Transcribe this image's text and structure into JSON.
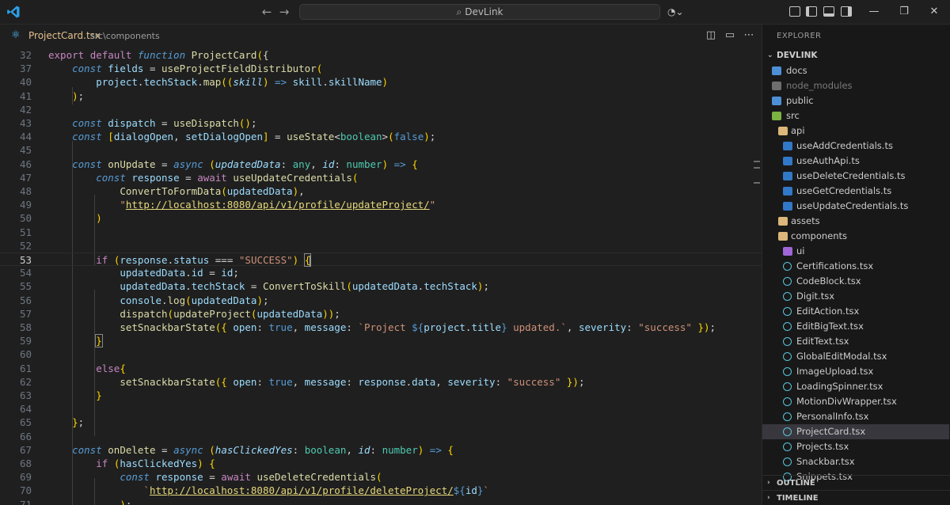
{
  "titlebar": {
    "search_text": "DevLink",
    "back_icon": "arrow-left-icon",
    "forward_icon": "arrow-right-icon"
  },
  "editor": {
    "tab_file": "ProjectCard.tsx",
    "tab_path": "src\\components"
  },
  "code_lines": [
    {
      "n": "32",
      "html": "<span class='k'>export</span> <span class='k'>default</span> <span class='s'>function</span> <span class='f'>ProjectCard</span><span class='br'>(</span><span class='o'>{</span>"
    },
    {
      "n": "37",
      "html": "    <span class='s'>const</span> <span class='v'>fields</span> <span class='o'>=</span> <span class='f'>useProjectFieldDistributor</span><span class='br'>(</span>"
    },
    {
      "n": "40",
      "html": "        <span class='v'>project</span>.<span class='v'>techStack</span>.<span class='f'>map</span><span class='br'>((</span><span class='p'>skill</span><span class='br'>)</span> <span class='b'>=&gt;</span> <span class='v'>skill</span>.<span class='v'>skillName</span><span class='br'>)</span>"
    },
    {
      "n": "41",
      "html": "    <span class='br'>)</span>;"
    },
    {
      "n": "42",
      "html": ""
    },
    {
      "n": "43",
      "html": "    <span class='s'>const</span> <span class='v'>dispatch</span> <span class='o'>=</span> <span class='f'>useDispatch</span><span class='br'>()</span>;"
    },
    {
      "n": "44",
      "html": "    <span class='s'>const</span> <span class='br'>[</span><span class='v'>dialogOpen</span>, <span class='v'>setDialogOpen</span><span class='br'>]</span> <span class='o'>=</span> <span class='f'>useState</span>&lt;<span class='t'>boolean</span>&gt;<span class='br'>(</span><span class='b'>false</span><span class='br'>)</span>;"
    },
    {
      "n": "45",
      "html": ""
    },
    {
      "n": "46",
      "html": "    <span class='s'>const</span> <span class='f'>onUpdate</span> <span class='o'>=</span> <span class='s'>async</span> <span class='br'>(</span><span class='p'>updatedData</span>: <span class='t'>any</span>, <span class='p'>id</span>: <span class='t'>number</span><span class='br'>)</span> <span class='b'>=&gt;</span> <span class='br'>{</span>"
    },
    {
      "n": "47",
      "html": "        <span class='s'>const</span> <span class='v'>response</span> <span class='o'>=</span> <span class='k'>await</span> <span class='f'>useUpdateCredentials</span><span class='br'>(</span>"
    },
    {
      "n": "48",
      "html": "            <span class='f'>ConvertToFormData</span><span class='br'>(</span><span class='v'>updatedData</span><span class='br'>)</span>,"
    },
    {
      "n": "49",
      "html": "            <span class='str'>\"</span><span class='url'>http://localhost:8080/api/v1/profile/updateProject/</span><span class='str'>\"</span>"
    },
    {
      "n": "50",
      "html": "        <span class='br'>)</span>"
    },
    {
      "n": "51",
      "html": ""
    },
    {
      "n": "52",
      "html": ""
    },
    {
      "n": "53",
      "html": "        <span class='k'>if</span> <span class='br'>(</span><span class='v'>response</span>.<span class='v'>status</span> <span class='o'>===</span> <span class='str'>\"SUCCESS\"</span><span class='br'>)</span> <span class='br' style='outline:1px solid #888'>{</span><span class='cursor'></span>"
    },
    {
      "n": "54",
      "html": "            <span class='v'>updatedData</span>.<span class='v'>id</span> <span class='o'>=</span> <span class='v'>id</span>;"
    },
    {
      "n": "55",
      "html": "            <span class='v'>updatedData</span>.<span class='v'>techStack</span> <span class='o'>=</span> <span class='f'>ConvertToSkill</span><span class='br'>(</span><span class='v'>updatedData</span>.<span class='v'>techStack</span><span class='br'>)</span>;"
    },
    {
      "n": "56",
      "html": "            <span class='v'>console</span>.<span class='f'>log</span><span class='br'>(</span><span class='v'>updatedData</span><span class='br'>)</span>;"
    },
    {
      "n": "57",
      "html": "            <span class='f'>dispatch</span><span class='br'>(</span><span class='f'>updateProject</span><span class='br'>(</span><span class='v'>updatedData</span><span class='br'>))</span>;"
    },
    {
      "n": "58",
      "html": "            <span class='f'>setSnackbarState</span><span class='br'>({</span> <span class='v'>open</span>: <span class='b'>true</span>, <span class='v'>message</span>: <span class='str'>`Project </span><span class='b'>${</span><span class='v'>project</span>.<span class='v'>title</span><span class='b'>}</span><span class='str'> updated.`</span>, <span class='v'>severity</span>: <span class='str'>\"success\"</span> <span class='br'>})</span>;"
    },
    {
      "n": "59",
      "html": "        <span class='br' style='outline:1px solid #888'>}</span>"
    },
    {
      "n": "60",
      "html": ""
    },
    {
      "n": "61",
      "html": "        <span class='k'>else</span><span class='br'>{</span>"
    },
    {
      "n": "62",
      "html": "            <span class='f'>setSnackbarState</span><span class='br'>({</span> <span class='v'>open</span>: <span class='b'>true</span>, <span class='v'>message</span>: <span class='v'>response</span>.<span class='v'>data</span>, <span class='v'>severity</span>: <span class='str'>\"success\"</span> <span class='br'>})</span>;"
    },
    {
      "n": "63",
      "html": "        <span class='br'>}</span>"
    },
    {
      "n": "64",
      "html": ""
    },
    {
      "n": "65",
      "html": "    <span class='br'>}</span>;"
    },
    {
      "n": "66",
      "html": ""
    },
    {
      "n": "67",
      "html": "    <span class='s'>const</span> <span class='f'>onDelete</span> <span class='o'>=</span> <span class='s'>async</span> <span class='br'>(</span><span class='p'>hasClickedYes</span>: <span class='t'>boolean</span>, <span class='p'>id</span>: <span class='t'>number</span><span class='br'>)</span> <span class='b'>=&gt;</span> <span class='br'>{</span>"
    },
    {
      "n": "68",
      "html": "        <span class='k'>if</span> <span class='br'>(</span><span class='v'>hasClickedYes</span><span class='br'>)</span> <span class='br'>{</span>"
    },
    {
      "n": "69",
      "html": "            <span class='s'>const</span> <span class='v'>response</span> <span class='o'>=</span> <span class='k'>await</span> <span class='f'>useDeleteCredentials</span><span class='br'>(</span>"
    },
    {
      "n": "70",
      "html": "                <span class='str'>`</span><span class='url'>http://localhost:8080/api/v1/profile/deleteProject/</span><span class='b'>${</span><span class='v'>id</span><span class='b'>}</span><span class='str'>`</span>"
    },
    {
      "n": "71",
      "html": "            <span class='br'>)</span>;"
    }
  ],
  "sidebar": {
    "title": "EXPLORER",
    "root": "DEVLINK",
    "items": [
      {
        "label": "docs",
        "indent": 0,
        "icon": "folder-blue",
        "chev": "›",
        "dim": false
      },
      {
        "label": "node_modules",
        "indent": 0,
        "icon": "folder-gray",
        "chev": "›",
        "dim": true
      },
      {
        "label": "public",
        "indent": 0,
        "icon": "folder-blue",
        "chev": "›",
        "dim": false
      },
      {
        "label": "src",
        "indent": 0,
        "icon": "folder-green",
        "chev": "⌄",
        "dim": false
      },
      {
        "label": "api",
        "indent": 1,
        "icon": "folder",
        "chev": "⌄",
        "dim": false
      },
      {
        "label": "useAddCredentials.ts",
        "indent": 2,
        "icon": "ts",
        "chev": "",
        "dim": false
      },
      {
        "label": "useAuthApi.ts",
        "indent": 2,
        "icon": "ts",
        "chev": "",
        "dim": false
      },
      {
        "label": "useDeleteCredentials.ts",
        "indent": 2,
        "icon": "ts",
        "chev": "",
        "dim": false
      },
      {
        "label": "useGetCredentials.ts",
        "indent": 2,
        "icon": "ts",
        "chev": "",
        "dim": false
      },
      {
        "label": "useUpdateCredentials.ts",
        "indent": 2,
        "icon": "ts",
        "chev": "",
        "dim": false
      },
      {
        "label": "assets",
        "indent": 1,
        "icon": "folder",
        "chev": "›",
        "dim": false
      },
      {
        "label": "components",
        "indent": 1,
        "icon": "folder",
        "chev": "⌄",
        "dim": false
      },
      {
        "label": "ui",
        "indent": 2,
        "icon": "folder-purple",
        "chev": "›",
        "dim": false
      },
      {
        "label": "Certifications.tsx",
        "indent": 2,
        "icon": "react",
        "chev": "",
        "dim": false
      },
      {
        "label": "CodeBlock.tsx",
        "indent": 2,
        "icon": "react",
        "chev": "",
        "dim": false
      },
      {
        "label": "Digit.tsx",
        "indent": 2,
        "icon": "react",
        "chev": "",
        "dim": false
      },
      {
        "label": "EditAction.tsx",
        "indent": 2,
        "icon": "react",
        "chev": "",
        "dim": false
      },
      {
        "label": "EditBigText.tsx",
        "indent": 2,
        "icon": "react",
        "chev": "",
        "dim": false
      },
      {
        "label": "EditText.tsx",
        "indent": 2,
        "icon": "react",
        "chev": "",
        "dim": false
      },
      {
        "label": "GlobalEditModal.tsx",
        "indent": 2,
        "icon": "react",
        "chev": "",
        "dim": false
      },
      {
        "label": "ImageUpload.tsx",
        "indent": 2,
        "icon": "react",
        "chev": "",
        "dim": false
      },
      {
        "label": "LoadingSpinner.tsx",
        "indent": 2,
        "icon": "react",
        "chev": "",
        "dim": false
      },
      {
        "label": "MotionDivWrapper.tsx",
        "indent": 2,
        "icon": "react",
        "chev": "",
        "dim": false
      },
      {
        "label": "PersonalInfo.tsx",
        "indent": 2,
        "icon": "react",
        "chev": "",
        "dim": false
      },
      {
        "label": "ProjectCard.tsx",
        "indent": 2,
        "icon": "react",
        "chev": "",
        "dim": false,
        "selected": true
      },
      {
        "label": "Projects.tsx",
        "indent": 2,
        "icon": "react",
        "chev": "",
        "dim": false
      },
      {
        "label": "Snackbar.tsx",
        "indent": 2,
        "icon": "react",
        "chev": "",
        "dim": false
      },
      {
        "label": "Snippets.tsx",
        "indent": 2,
        "icon": "react",
        "chev": "",
        "dim": false
      }
    ],
    "outline_label": "OUTLINE",
    "timeline_label": "TIMELINE"
  },
  "colors": {
    "background": "#1f1f1f",
    "sidebar": "#181818",
    "selected": "#37373d",
    "accent": "#007acc"
  }
}
